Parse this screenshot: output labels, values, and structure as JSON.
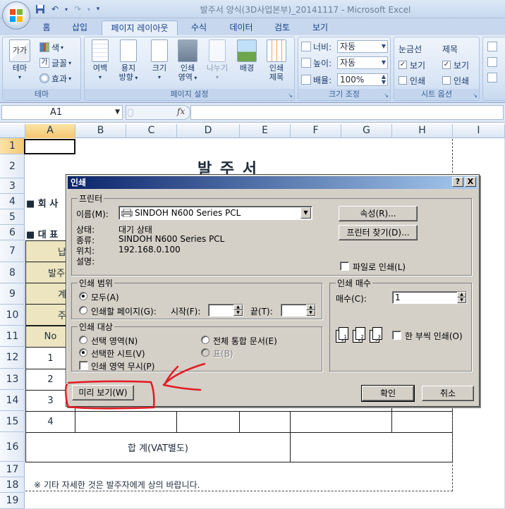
{
  "window": {
    "title": "발주서 양식(3D사업본부)_20141117 - Microsoft Excel"
  },
  "ribbon": {
    "tabs": [
      "홈",
      "삽입",
      "페이지 레이아웃",
      "수식",
      "데이터",
      "검토",
      "보기"
    ],
    "active_tab": "페이지 레이아웃",
    "groups": {
      "theme": {
        "label": "테마",
        "theme_button": "테마",
        "colors": "색",
        "fonts": "글꼴",
        "effects": "효과"
      },
      "page_setup": {
        "label": "페이지 설정",
        "margins": "여백",
        "orientation": [
          "용지",
          "방향"
        ],
        "size": "크기",
        "print_area": [
          "인쇄",
          "영역"
        ],
        "breaks": "나누기",
        "background": "배경",
        "print_titles": [
          "인쇄",
          "제목"
        ]
      },
      "scale_to_fit": {
        "label": "크기 조정",
        "width_label": "너비:",
        "width_value": "자동",
        "height_label": "높이:",
        "height_value": "자동",
        "scale_label": "배율:",
        "scale_value": "100%"
      },
      "sheet_options": {
        "label": "시트 옵션",
        "gridlines": "눈금선",
        "headings": "제목",
        "view": "보기",
        "print": "인쇄"
      }
    }
  },
  "formula_bar": {
    "name_box": "A1",
    "fx": "fx",
    "content": ""
  },
  "sheet": {
    "columns": [
      "A",
      "B",
      "C",
      "D",
      "E",
      "F",
      "G",
      "H",
      "I"
    ],
    "rows": [
      "1",
      "2",
      "3",
      "4",
      "5",
      "6",
      "7",
      "8",
      "9",
      "10",
      "11",
      "12",
      "13",
      "14",
      "15",
      "16",
      "17",
      "18",
      "19"
    ],
    "title": "발 주 서",
    "company_label": "■ 회 사",
    "representative_label": "■ 대 표",
    "row7_label": "납",
    "row8_label": "발주금",
    "row9_label": "계",
    "row10_label": "주",
    "no_header": "No",
    "item_numbers": [
      "1",
      "2",
      "3",
      "4"
    ],
    "total_label": "합 계(VAT별도)",
    "footer_note": "※ 기타 자세한 것은 발주자에게 상의 바랍니다."
  },
  "dialog": {
    "title": "인쇄",
    "help_btn": "?",
    "close_btn": "X",
    "printer_group": "프린터",
    "name_label": "이름(M):",
    "printer_name": "SINDOH N600 Series PCL",
    "status_label": "상태:",
    "status_value": "대기 상태",
    "type_label": "종류:",
    "type_value": "SINDOH N600 Series PCL",
    "location_label": "위치:",
    "location_value": "192.168.0.100",
    "comment_label": "설명:",
    "properties_btn": "속성(R)...",
    "find_printer_btn": "프린터 찾기(D)...",
    "print_to_file": "파일로 인쇄(L)",
    "range_group": "인쇄 범위",
    "range_all": "모두(A)",
    "range_pages": "인쇄할 페이지(G):",
    "from_label": "시작(F):",
    "to_label": "끝(T):",
    "what_group": "인쇄 대상",
    "what_selection": "선택 영역(N)",
    "what_workbook": "전체 통합 문서(E)",
    "what_active": "선택한 시트(V)",
    "what_table": "표(B)",
    "ignore_print_area": "인쇄 영역 무시(P)",
    "copies_group": "인쇄 매수",
    "copies_label": "매수(C):",
    "copies_value": "1",
    "collate": "한 부씩 인쇄(O)",
    "preview_btn": "미리 보기(W)",
    "ok_btn": "확인",
    "cancel_btn": "취소"
  },
  "colors": {
    "ribbon_bg": "#d4e2f4",
    "header_fill": "#ece5bf",
    "dialog_face": "#d4d0c8",
    "dialog_title": "#0a246a",
    "annotation_red": "#e31b23"
  }
}
